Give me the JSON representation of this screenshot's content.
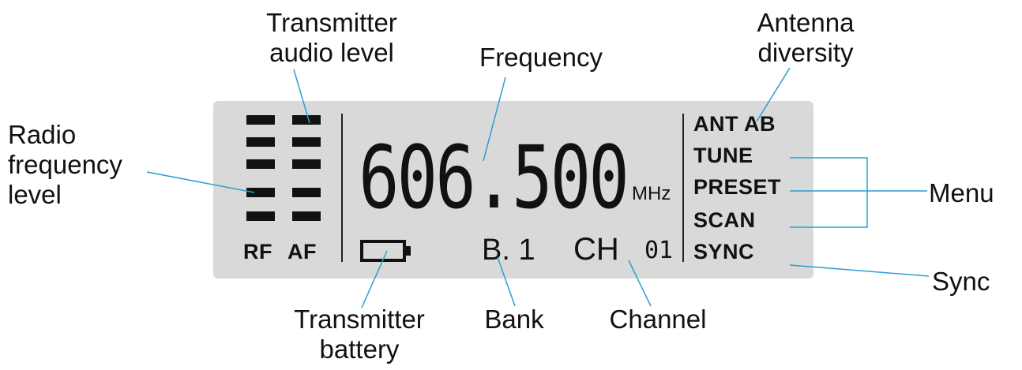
{
  "callouts": {
    "transmitter_audio_level": [
      "Transmitter",
      "audio level"
    ],
    "frequency": "Frequency",
    "antenna_diversity": [
      "Antenna",
      "diversity"
    ],
    "radio_frequency_level": [
      "Radio",
      "frequency",
      "level"
    ],
    "menu": "Menu",
    "sync": "Sync",
    "transmitter_battery": [
      "Transmitter",
      "battery"
    ],
    "bank": "Bank",
    "channel": "Channel"
  },
  "display": {
    "frequency_value": "606.500",
    "frequency_unit": "MHz",
    "rf_label": "RF",
    "af_label": "AF",
    "bank_value": "B. 1",
    "channel_prefix": "CH",
    "channel_value": "01",
    "antenna_label": "ANT AB",
    "menu_items": [
      "TUNE",
      "PRESET",
      "SCAN"
    ],
    "sync_label": "SYNC",
    "rf_level_fraction": 0.4,
    "af_level_fraction": 1.0
  },
  "colors": {
    "lcd_background": "#d9d9d9",
    "leader_line": "#2a9fd0",
    "segment": "#111111"
  }
}
